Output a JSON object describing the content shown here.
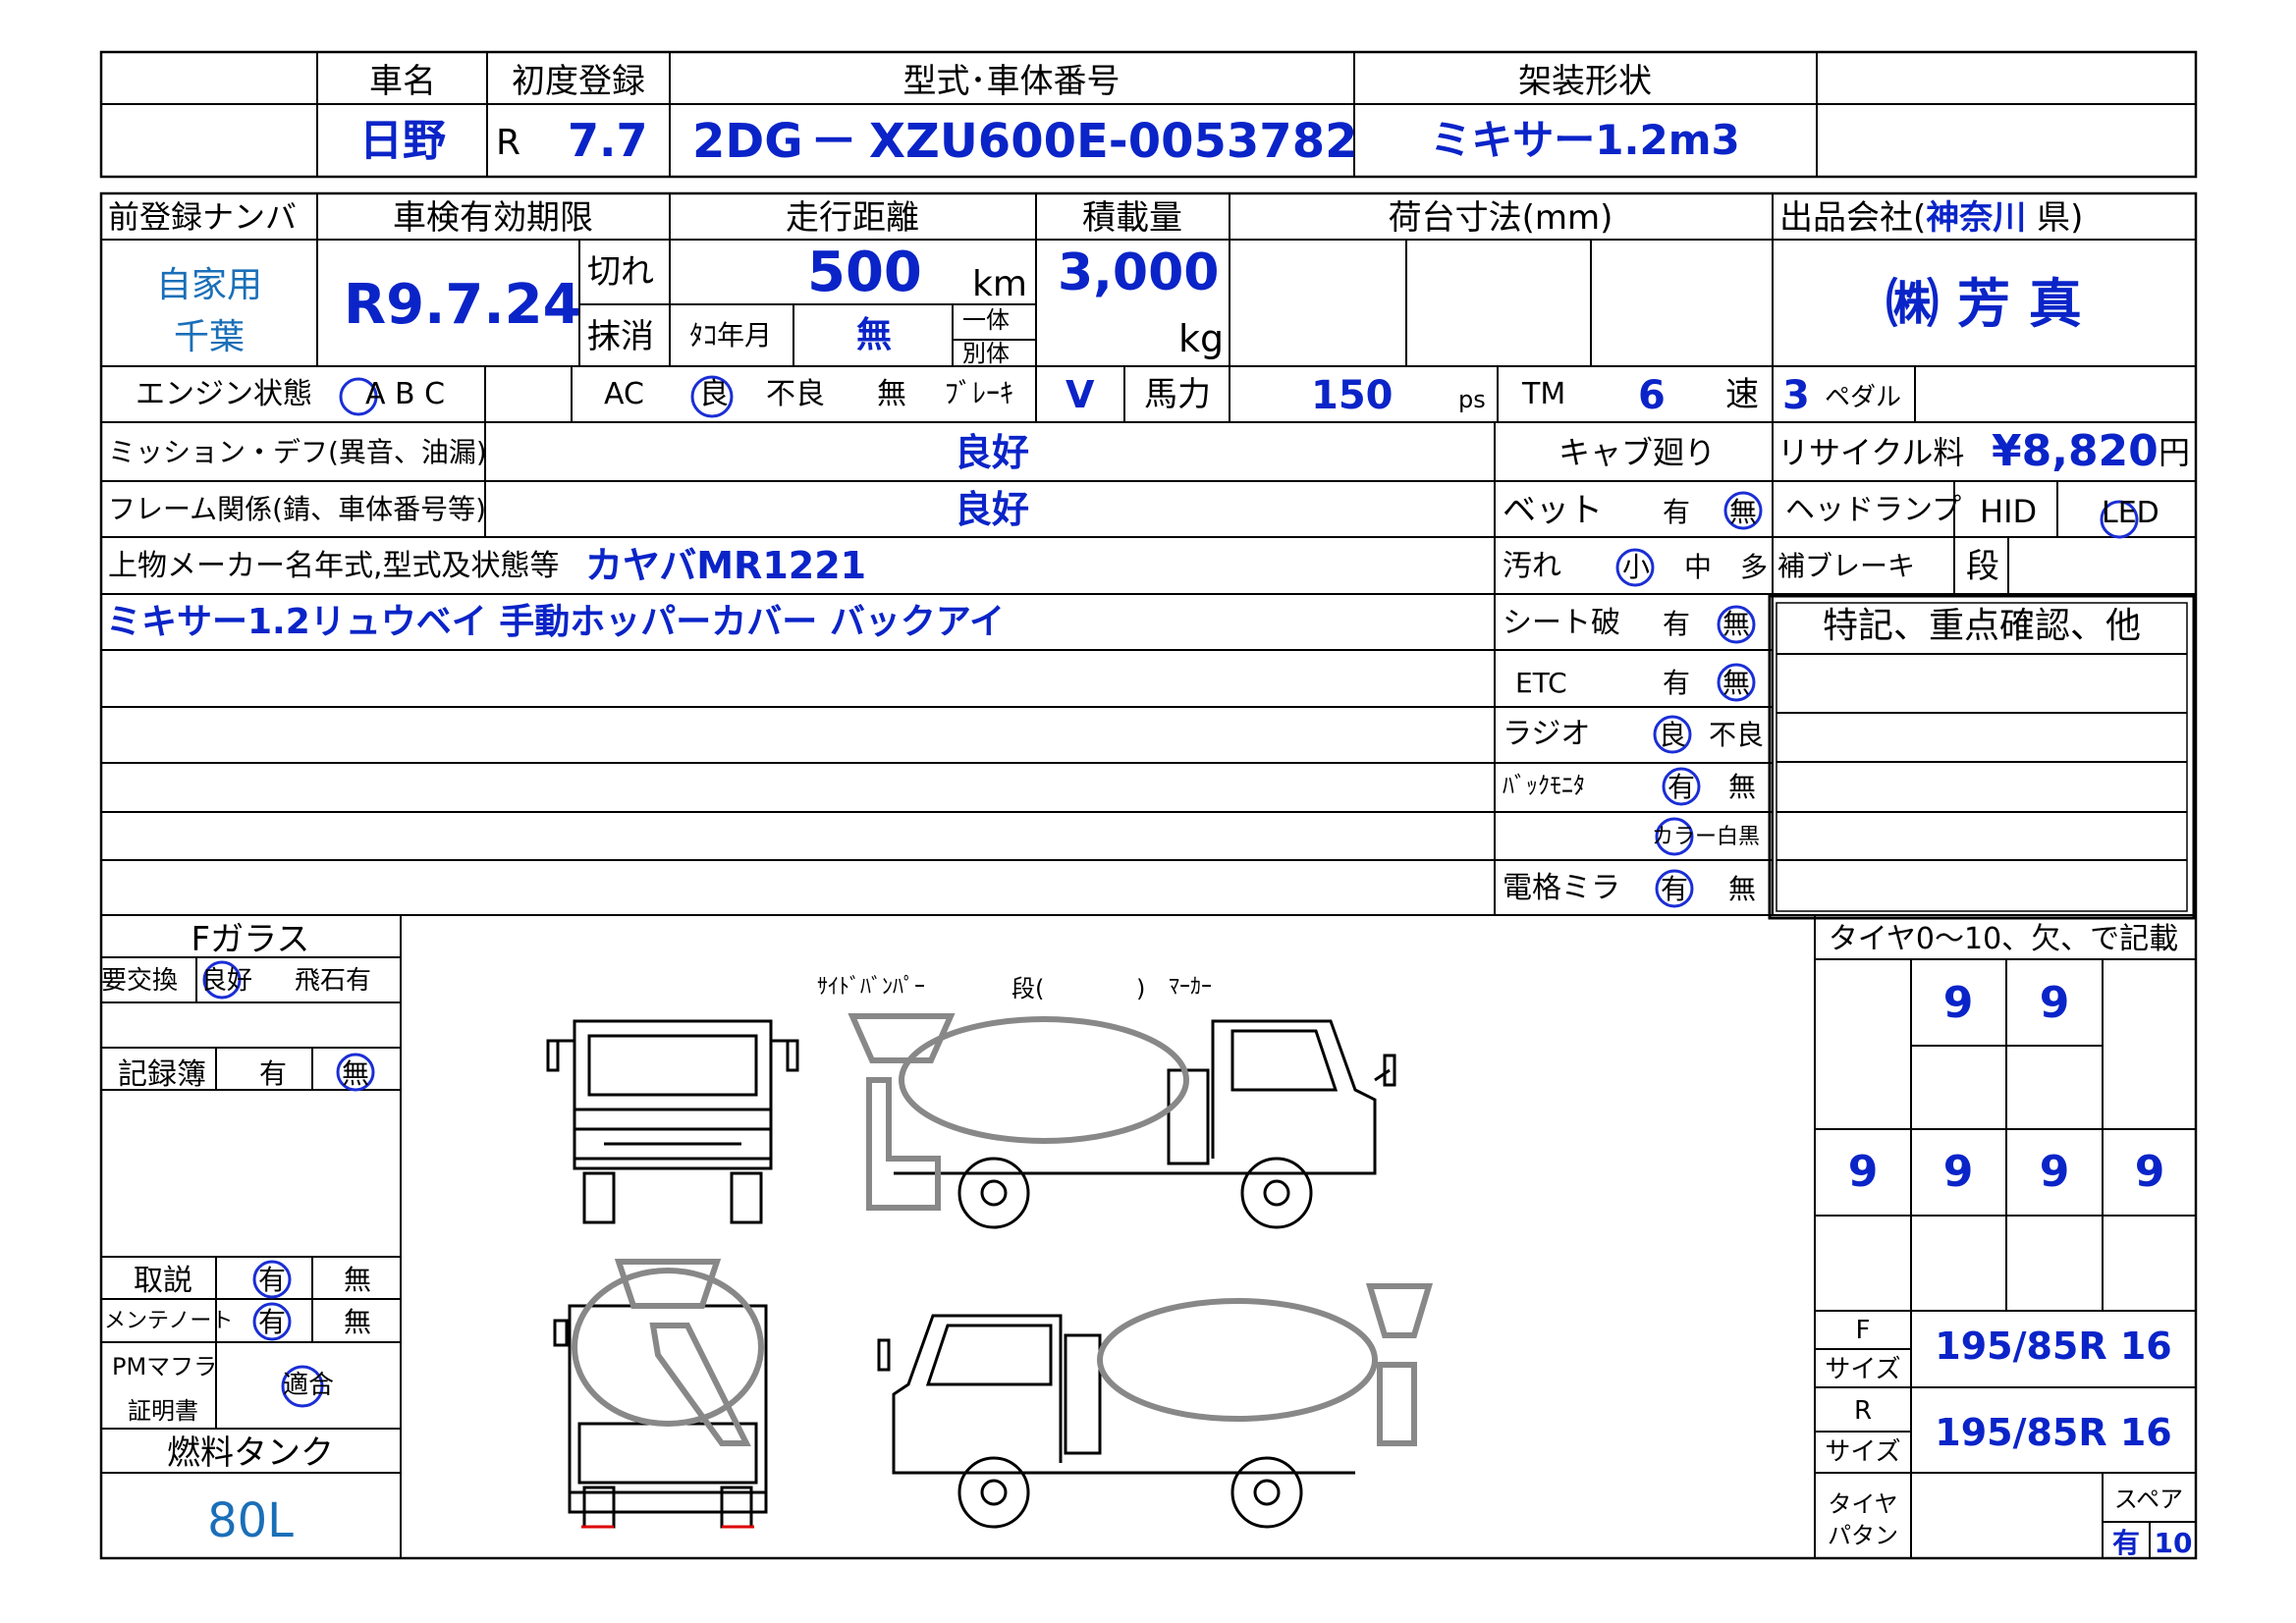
{
  "header": {
    "car_name_label": "車名",
    "first_reg_label": "初度登録",
    "model_label": "型式･車体番号",
    "body_type_label": "架装形状",
    "car_name": "日野",
    "era": "R",
    "first_reg": "7.7",
    "model_code": "2DG",
    "dash": "－",
    "chassis_no": "XZU600E-0053782",
    "body_type": "ミキサー1.2m3"
  },
  "row2": {
    "prev_plate_label": "前登録ナンバ",
    "inspection_label": "車検有効期限",
    "mileage_label": "走行距離",
    "load_label": "積載量",
    "bed_label": "荷台寸法(mm)",
    "seller_label_prefix": "出品会社(",
    "seller_pref": "神奈川",
    "seller_label_suffix": "県)",
    "plate_use": "自家用",
    "plate_region": "千葉",
    "inspection": "R9.7.24",
    "expired": "切れ",
    "deleted": "抹消",
    "mileage": "500",
    "km": "km",
    "tacho_label": "ﾀｺ年月",
    "tacho_value": "無",
    "ittai": "一体",
    "betai": "別体",
    "load": "3,000",
    "kg": "kg",
    "seller": "㈱ 芳 真"
  },
  "row3": {
    "engine_label": "エンジン状態",
    "engine_grades": "A B C",
    "ac_label": "AC",
    "ac_good": "良",
    "ac_bad": "不良",
    "ac_none": "無",
    "brake_label": "ﾌﾞﾚｰｷ",
    "brake_value": "V",
    "hp_label": "馬力",
    "hp_value": "150",
    "ps": "ps",
    "tm_label": "TM",
    "tm_value": "6",
    "speed": "速",
    "pedal_value": "3",
    "pedal_label": "ペダル"
  },
  "inspection_rows": {
    "mission_label": "ミッション・デフ(異音、油漏)",
    "mission_value": "良好",
    "frame_label": "フレーム関係(錆、車体番号等)",
    "frame_value": "良好",
    "upper_label": "上物メーカー名年式,型式及状態等",
    "upper_value": "カヤバMR1221",
    "notes_line": "ミキサー1.2リュウベイ 手動ホッパーカバー バックアイ"
  },
  "cab": {
    "cab_label": "キャブ廻り",
    "bed_label": "ベット",
    "bed_yes": "有",
    "bed_no": "無",
    "dirt_label": "汚れ",
    "dirt_small": "小",
    "dirt_mid": "中",
    "dirt_large": "多",
    "seat_label": "シート破",
    "seat_yes": "有",
    "seat_no": "無",
    "etc_label": "ETC",
    "etc_yes": "有",
    "etc_no": "無",
    "radio_label": "ラジオ",
    "radio_good": "良",
    "radio_bad": "不良",
    "backmon_label": "ﾊﾞｯｸﾓﾆﾀ",
    "backmon_yes": "有",
    "backmon_no": "無",
    "color": "カラー",
    "bw": "白黒",
    "mirror_label": "電格ミラ",
    "mirror_yes": "有",
    "mirror_no": "無"
  },
  "right": {
    "recycle_label": "リサイクル料",
    "recycle_value": "¥8,820",
    "yen": "円",
    "headlamp_label": "ヘッドランプ",
    "hid": "HID",
    "led": "LED",
    "aux_brake_label": "補ブレーキ",
    "aux_brake_value": "段",
    "special_label": "特記、重点確認、他"
  },
  "left_bottom": {
    "glass_label": "Fガラス",
    "glass_replace": "要交換",
    "glass_good": "良好",
    "glass_chip": "飛石有",
    "record_label": "記録簿",
    "record_yes": "有",
    "record_no": "無",
    "manual_label": "取説",
    "manual_yes": "有",
    "manual_no": "無",
    "maint_label": "メンテノート",
    "maint_yes": "有",
    "maint_no": "無",
    "pm_label1": "PMマフラ",
    "pm_label2": "証明書",
    "pm_value": "適合",
    "fuel_label": "燃料タンク",
    "fuel_value": "80L"
  },
  "diagram": {
    "annotation_bumper": "ｻｲﾄﾞﾊﾞﾝﾊﾟｰ",
    "annotation_step": "段(",
    "annotation_close": ")",
    "annotation_marker": "ﾏｰｶｰ"
  },
  "tires": {
    "title": "タイヤ0〜10、欠、で記載",
    "front": [
      "9",
      "9"
    ],
    "rear": [
      "9",
      "9",
      "9",
      "9"
    ],
    "f_label": "F",
    "r_label": "R",
    "size_label": "サイズ",
    "f_size": "195/85R 16",
    "r_size": "195/85R 16",
    "pattern_label1": "タイヤ",
    "pattern_label2": "パタン",
    "spare_label": "スペア",
    "spare_has": "有",
    "spare_value": "10"
  },
  "colors": {
    "blue": "#0a24c8",
    "circle": "#1a2ed6",
    "diagram": "#888888"
  }
}
